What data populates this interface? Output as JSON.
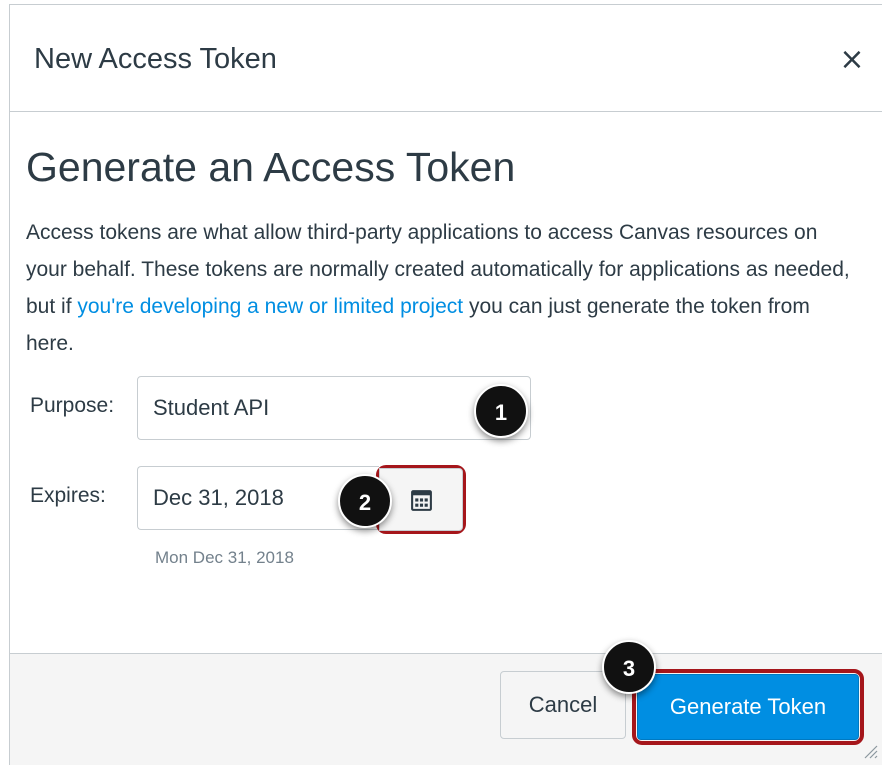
{
  "dialog": {
    "title": "New Access Token",
    "close_label": "×"
  },
  "content": {
    "heading": "Generate an Access Token",
    "description_before": "Access tokens are what allow third-party applications to access Canvas resources on your behalf. These tokens are normally created automatically for applications as needed, but if ",
    "description_link": "you're developing a new or limited project",
    "description_after": " you can just generate the token from here."
  },
  "form": {
    "purpose_label": "Purpose:",
    "purpose_value": "Student API",
    "expires_label": "Expires:",
    "expires_value": "Dec 31, 2018",
    "expires_help": "Mon Dec 31, 2018"
  },
  "callouts": [
    "1",
    "2",
    "3"
  ],
  "footer": {
    "cancel_label": "Cancel",
    "generate_label": "Generate Token"
  },
  "colors": {
    "accent": "#008ee2",
    "highlight": "#a5161b",
    "text": "#2d3b45"
  },
  "icons": {
    "close": "close-icon",
    "calendar": "calendar-icon",
    "resize": "resize-grip-icon"
  }
}
